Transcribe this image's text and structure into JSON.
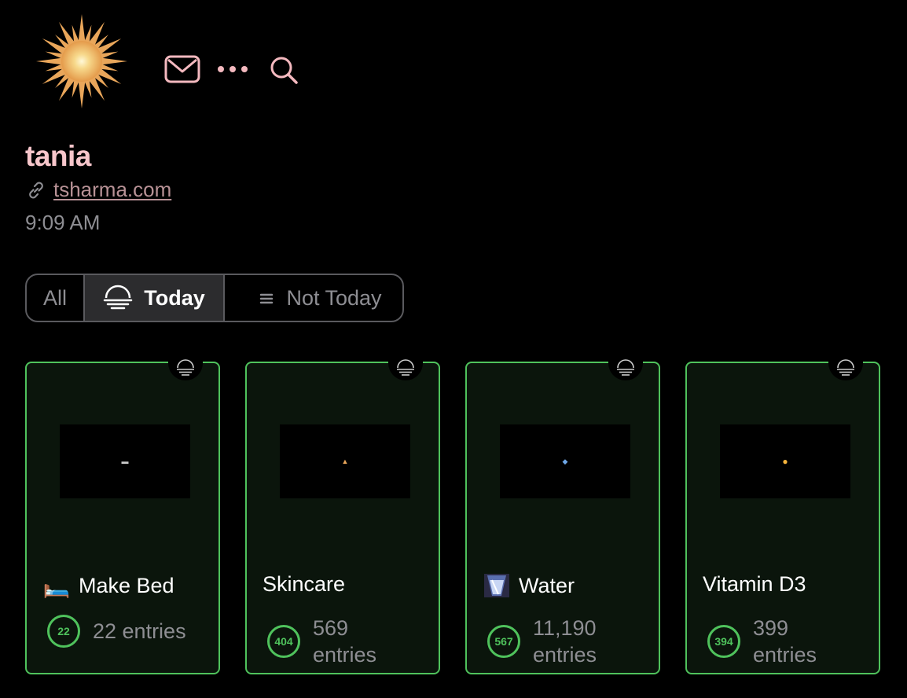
{
  "header": {
    "icons": [
      "sun-avatar-icon",
      "mail-icon",
      "more-icon",
      "search-icon"
    ]
  },
  "profile": {
    "name": "tania",
    "link": "tsharma.com",
    "time": "9:09 AM"
  },
  "filter": {
    "options": [
      {
        "label": "All"
      },
      {
        "label": "Today",
        "selected": true
      },
      {
        "label": "Not Today"
      }
    ]
  },
  "habits": [
    {
      "title": "Make Bed",
      "emoji": "🛏️",
      "count": "22",
      "entries": "22 entries"
    },
    {
      "title": "Skincare",
      "emoji": "",
      "count": "404",
      "entries": "569 entries"
    },
    {
      "title": "Water",
      "emoji": "💧",
      "count": "567",
      "entries": "11,190 entries"
    },
    {
      "title": "Vitamin D3",
      "emoji": "",
      "count": "394",
      "entries": "399 entries"
    }
  ],
  "colors": {
    "accent_green": "#4fc25c",
    "name_pink": "#f7c6cb",
    "icon_pink": "#f4b9bf",
    "muted": "#8e8e93"
  }
}
